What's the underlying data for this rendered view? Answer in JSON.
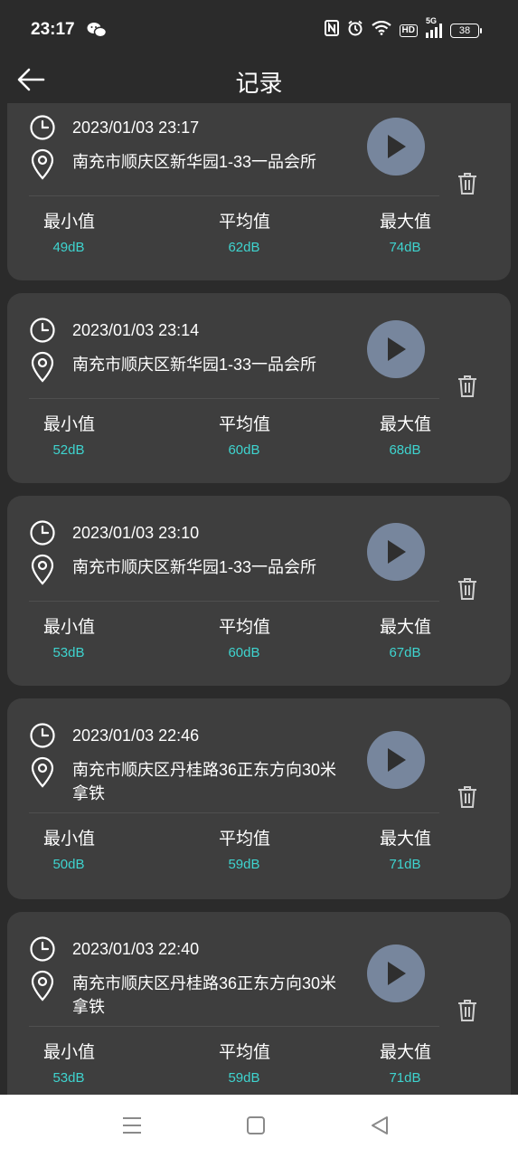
{
  "status_bar": {
    "time": "23:17",
    "battery": "38",
    "network_badge": "HD",
    "network_type": "5G"
  },
  "header": {
    "title": "记录"
  },
  "stat_labels": {
    "min": "最小值",
    "avg": "平均值",
    "max": "最大值"
  },
  "records": [
    {
      "datetime": "2023/01/03 23:17",
      "location": "南充市顺庆区新华园1-33一品会所",
      "min": "49dB",
      "avg": "62dB",
      "max": "74dB"
    },
    {
      "datetime": "2023/01/03 23:14",
      "location": "南充市顺庆区新华园1-33一品会所",
      "min": "52dB",
      "avg": "60dB",
      "max": "68dB"
    },
    {
      "datetime": "2023/01/03 23:10",
      "location": "南充市顺庆区新华园1-33一品会所",
      "min": "53dB",
      "avg": "60dB",
      "max": "67dB"
    },
    {
      "datetime": "2023/01/03 22:46",
      "location": "南充市顺庆区丹桂路36正东方向30米拿铁",
      "min": "50dB",
      "avg": "59dB",
      "max": "71dB"
    },
    {
      "datetime": "2023/01/03 22:40",
      "location": "南充市顺庆区丹桂路36正东方向30米拿铁",
      "min": "53dB",
      "avg": "59dB",
      "max": "71dB"
    }
  ],
  "colors": {
    "background": "#2b2b2b",
    "card": "#3e3e3e",
    "accent_value": "#3ed4cf",
    "play_button": "#77869d"
  }
}
